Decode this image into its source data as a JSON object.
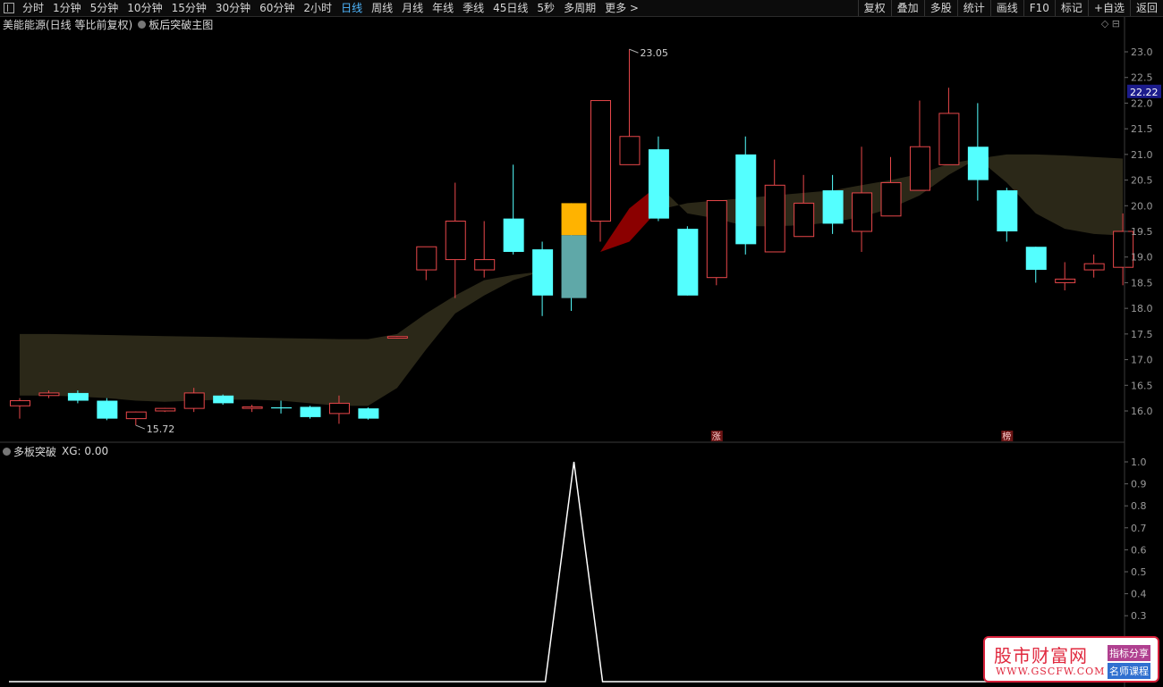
{
  "toolbar": {
    "tabs": [
      "分时",
      "1分钟",
      "5分钟",
      "10分钟",
      "15分钟",
      "30分钟",
      "60分钟",
      "2小时",
      "日线",
      "周线",
      "月线",
      "年线",
      "季线",
      "45日线",
      "5秒",
      "多周期",
      "更多 >"
    ],
    "active_tab": "日线",
    "right_buttons": [
      "复权",
      "叠加",
      "多股",
      "统计",
      "画线",
      "F10",
      "标记",
      "+自选",
      "返回"
    ]
  },
  "main_panel": {
    "stock_title": "美能能源(日线 等比前复权)",
    "indicator_title": "板后突破主图",
    "high_label": "23.05",
    "low_label": "15.72",
    "current_price": "22.22",
    "y_ticks": [
      "23.0",
      "22.5",
      "22.0",
      "21.5",
      "21.0",
      "20.5",
      "20.0",
      "19.5",
      "19.0",
      "18.5",
      "18.0",
      "17.5",
      "17.0",
      "16.5",
      "16.0"
    ],
    "markers": [
      "涨",
      "榜"
    ],
    "corner_icons": "◇ ⊟"
  },
  "sub_panel": {
    "name": "多板突破",
    "xg_label": "XG: 0.00",
    "y_ticks": [
      "1.0",
      "0.9",
      "0.8",
      "0.7",
      "0.6",
      "0.5",
      "0.4",
      "0.3"
    ]
  },
  "watermark": {
    "title": "股市财富网",
    "url": "WWW.GSCFW.COM",
    "tag1": "指标分享",
    "tag2": "名师课程"
  },
  "colors": {
    "up": "#e8474a",
    "down": "#54ffff",
    "band": "#2b2818",
    "red_band": "#8b0000",
    "highlight_top": "#ffb300",
    "highlight_bottom": "#5fa8a8"
  },
  "chart_data": {
    "type": "candlestick",
    "ylim": [
      15.4,
      23.3
    ],
    "candles": [
      {
        "o": 16.1,
        "c": 16.2,
        "h": 16.25,
        "l": 15.85,
        "dir": "up"
      },
      {
        "o": 16.3,
        "c": 16.35,
        "h": 16.4,
        "l": 16.25,
        "dir": "up"
      },
      {
        "o": 16.35,
        "c": 16.2,
        "h": 16.4,
        "l": 16.15,
        "dir": "down"
      },
      {
        "o": 16.2,
        "c": 15.85,
        "h": 16.25,
        "l": 15.82,
        "dir": "down"
      },
      {
        "o": 15.85,
        "c": 15.98,
        "h": 15.99,
        "l": 15.72,
        "dir": "up"
      },
      {
        "o": 16.0,
        "c": 16.05,
        "h": 16.06,
        "l": 15.98,
        "dir": "up"
      },
      {
        "o": 16.05,
        "c": 16.35,
        "h": 16.45,
        "l": 15.98,
        "dir": "up"
      },
      {
        "o": 16.3,
        "c": 16.15,
        "h": 16.32,
        "l": 16.12,
        "dir": "down"
      },
      {
        "o": 16.05,
        "c": 16.08,
        "h": 16.12,
        "l": 15.98,
        "dir": "up"
      },
      {
        "o": 16.07,
        "c": 16.05,
        "h": 16.2,
        "l": 15.95,
        "dir": "down"
      },
      {
        "o": 16.08,
        "c": 15.88,
        "h": 16.1,
        "l": 15.85,
        "dir": "down"
      },
      {
        "o": 15.95,
        "c": 16.15,
        "h": 16.3,
        "l": 15.75,
        "dir": "up"
      },
      {
        "o": 16.05,
        "c": 15.85,
        "h": 16.07,
        "l": 15.83,
        "dir": "down"
      },
      {
        "o": 17.42,
        "c": 17.45,
        "h": 17.46,
        "l": 17.41,
        "dir": "up"
      },
      {
        "o": 18.75,
        "c": 19.2,
        "h": 19.2,
        "l": 18.55,
        "dir": "up"
      },
      {
        "o": 18.95,
        "c": 19.7,
        "h": 20.45,
        "l": 18.2,
        "dir": "up"
      },
      {
        "o": 18.75,
        "c": 18.95,
        "h": 19.7,
        "l": 18.6,
        "dir": "up"
      },
      {
        "o": 19.75,
        "c": 19.1,
        "h": 20.8,
        "l": 19.05,
        "dir": "down"
      },
      {
        "o": 19.15,
        "c": 18.25,
        "h": 19.3,
        "l": 17.85,
        "dir": "down"
      },
      {
        "o": 20.05,
        "c": 18.2,
        "h": 20.05,
        "l": 17.95,
        "dir": "down",
        "highlight": true
      },
      {
        "o": 19.7,
        "c": 22.05,
        "h": 22.05,
        "l": 19.3,
        "dir": "up"
      },
      {
        "o": 20.8,
        "c": 21.35,
        "h": 23.05,
        "l": 20.8,
        "dir": "up"
      },
      {
        "o": 21.1,
        "c": 19.75,
        "h": 21.35,
        "l": 19.7,
        "dir": "down"
      },
      {
        "o": 19.55,
        "c": 18.25,
        "h": 19.6,
        "l": 18.25,
        "dir": "down"
      },
      {
        "o": 18.6,
        "c": 20.1,
        "h": 20.1,
        "l": 18.45,
        "dir": "up"
      },
      {
        "o": 21.0,
        "c": 19.25,
        "h": 21.35,
        "l": 19.05,
        "dir": "down"
      },
      {
        "o": 19.1,
        "c": 20.4,
        "h": 20.9,
        "l": 19.1,
        "dir": "up"
      },
      {
        "o": 19.4,
        "c": 20.05,
        "h": 20.6,
        "l": 19.4,
        "dir": "up"
      },
      {
        "o": 20.3,
        "c": 19.65,
        "h": 20.6,
        "l": 19.45,
        "dir": "down"
      },
      {
        "o": 19.5,
        "c": 20.25,
        "h": 21.15,
        "l": 19.1,
        "dir": "up"
      },
      {
        "o": 19.8,
        "c": 20.45,
        "h": 20.95,
        "l": 19.8,
        "dir": "up"
      },
      {
        "o": 20.3,
        "c": 21.15,
        "h": 22.05,
        "l": 20.3,
        "dir": "up"
      },
      {
        "o": 20.8,
        "c": 21.8,
        "h": 22.3,
        "l": 20.8,
        "dir": "up"
      },
      {
        "o": 21.15,
        "c": 20.5,
        "h": 22.0,
        "l": 20.1,
        "dir": "down"
      },
      {
        "o": 20.3,
        "c": 19.5,
        "h": 20.35,
        "l": 19.3,
        "dir": "down"
      },
      {
        "o": 19.2,
        "c": 18.75,
        "h": 19.2,
        "l": 18.5,
        "dir": "down"
      },
      {
        "o": 18.5,
        "c": 18.57,
        "h": 18.9,
        "l": 18.35,
        "dir": "up"
      },
      {
        "o": 18.75,
        "c": 18.87,
        "h": 19.05,
        "l": 18.6,
        "dir": "up"
      },
      {
        "o": 18.8,
        "c": 19.5,
        "h": 19.85,
        "l": 18.45,
        "dir": "up"
      }
    ],
    "xg_values": [
      0,
      0,
      0,
      0,
      0,
      0,
      0,
      0,
      0,
      0,
      0,
      0,
      0,
      0,
      0,
      0,
      0,
      0,
      0,
      1,
      0,
      0,
      0,
      0,
      0,
      0,
      0,
      0,
      0,
      0,
      0,
      0,
      0,
      0,
      0,
      0,
      0,
      0,
      0
    ],
    "xg_ylim": [
      0,
      1.0
    ]
  }
}
